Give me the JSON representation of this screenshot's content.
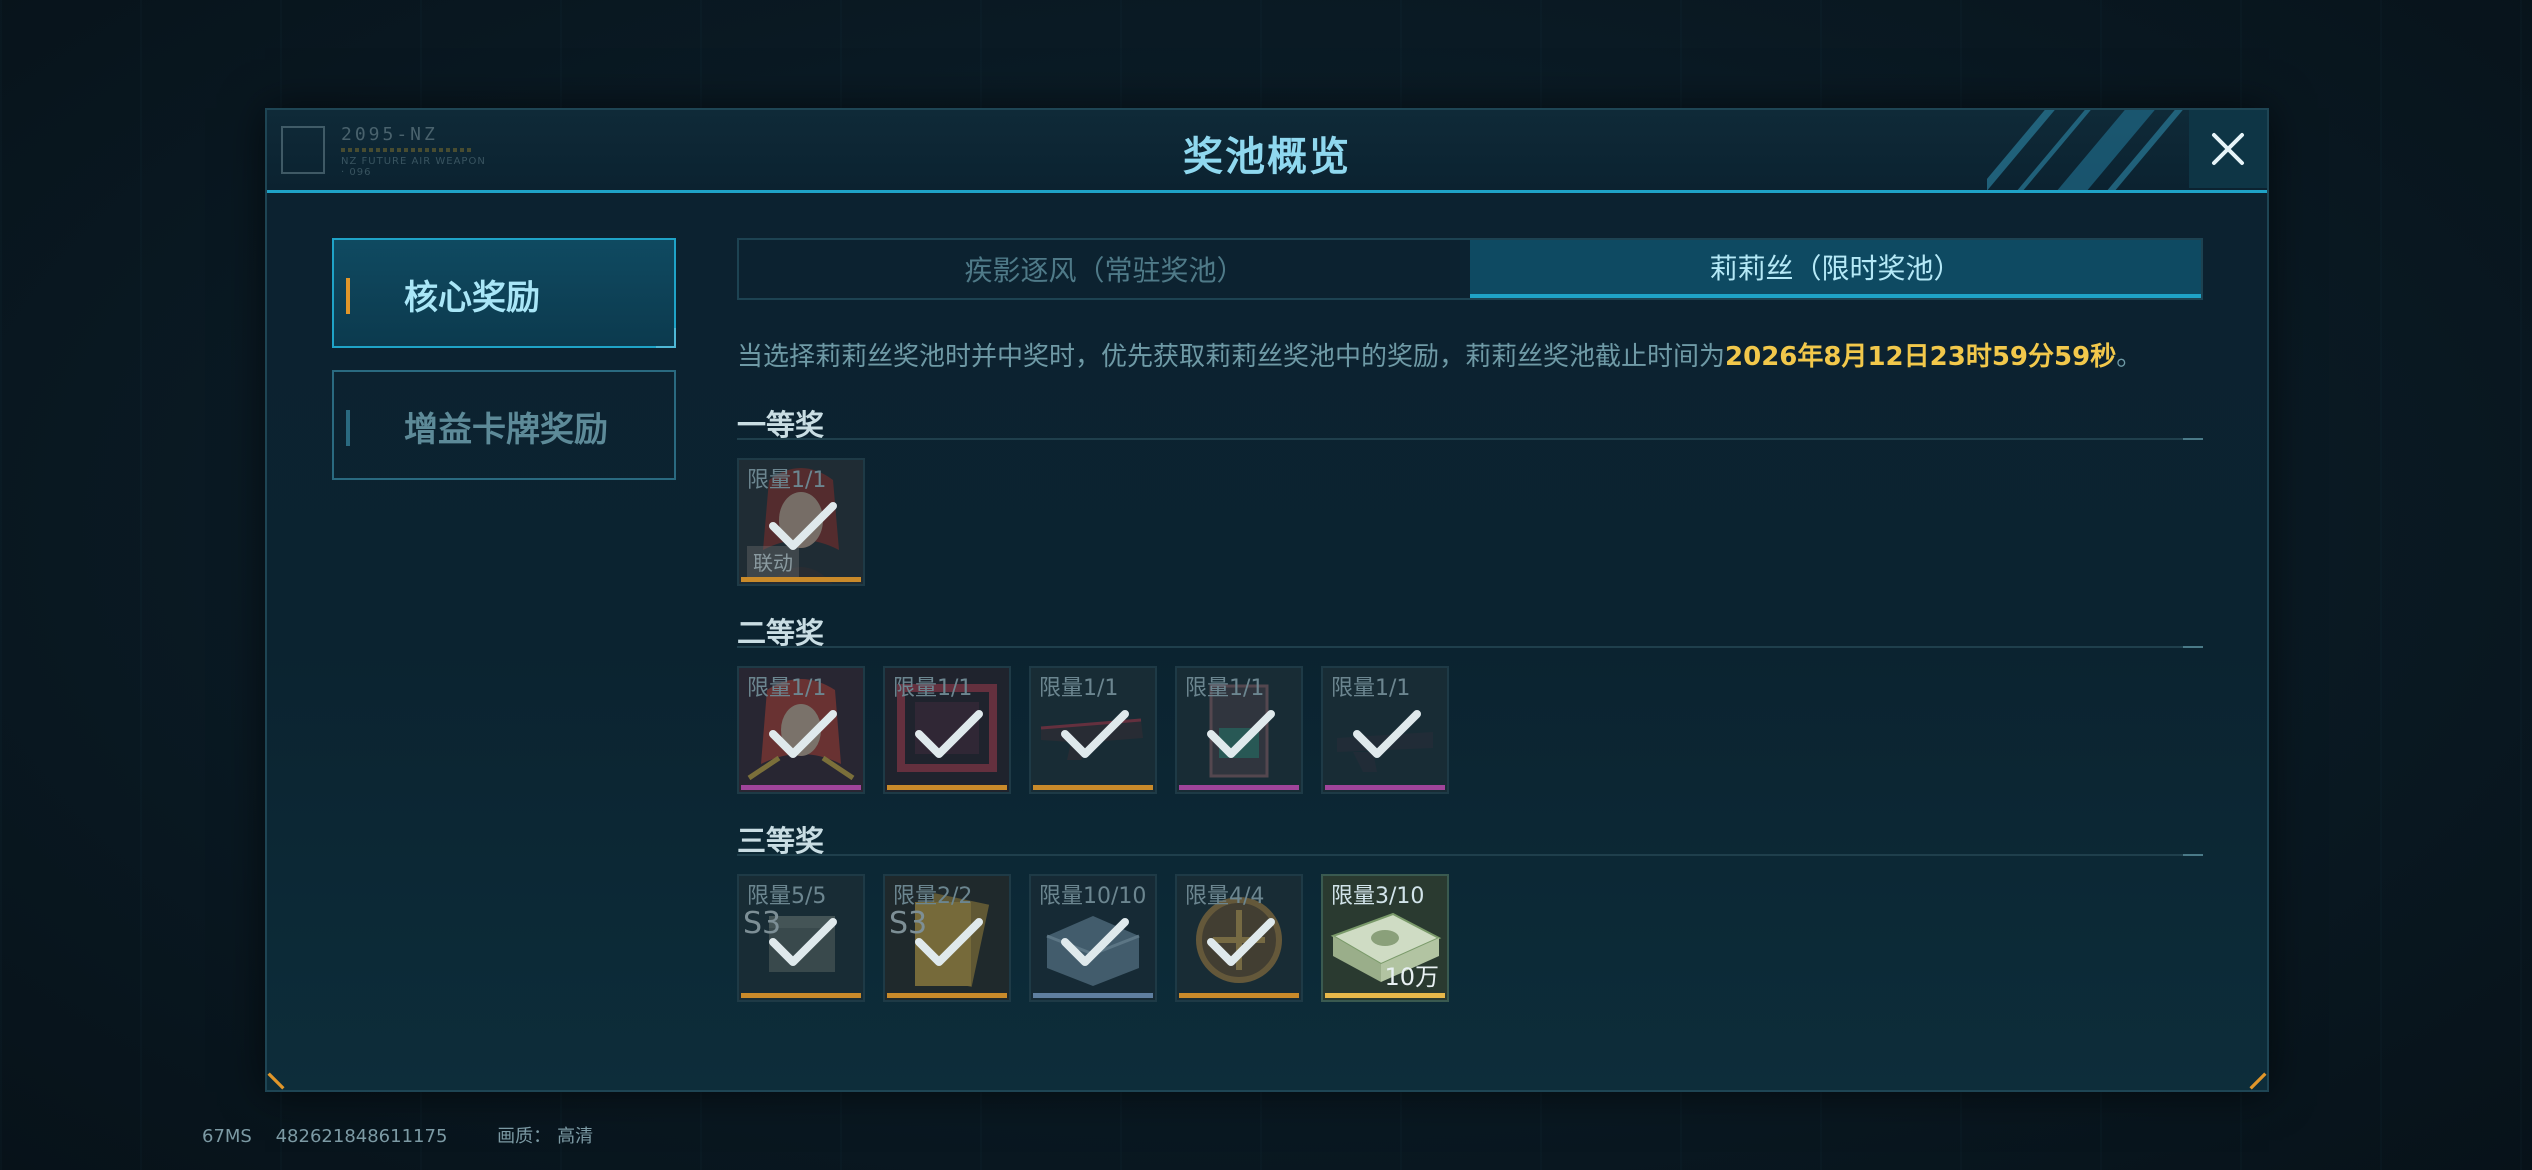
{
  "dialog": {
    "title": "奖池概览",
    "logo_code": "2095-NZ",
    "logo_sub": "NZ FUTURE AIR WEAPON · 096"
  },
  "nav": [
    {
      "label": "核心奖励",
      "active": true
    },
    {
      "label": "增益卡牌奖励",
      "active": false
    }
  ],
  "tabs": [
    {
      "label": "疾影逐风（常驻奖池）",
      "active": false
    },
    {
      "label": "莉莉丝（限时奖池）",
      "active": true
    }
  ],
  "notice": {
    "text": "当选择莉莉丝奖池时并中奖时，优先获取莉莉丝奖池中的奖励，莉莉丝奖池截止时间为",
    "deadline": "2026年8月12日23时59分59秒",
    "suffix": "。"
  },
  "sections": [
    {
      "title": "一等奖",
      "items": [
        {
          "limit": "限量1/1",
          "tag": "联动",
          "claimed": true,
          "rarity_color": "#c98a2a",
          "art": "portrait-red-hair"
        }
      ]
    },
    {
      "title": "二等奖",
      "items": [
        {
          "limit": "限量1/1",
          "claimed": true,
          "rarity_color": "#a0449a",
          "art": "portrait-red-hair-gold"
        },
        {
          "limit": "限量1/1",
          "claimed": true,
          "rarity_color": "#c98a2a",
          "art": "frame-crimson"
        },
        {
          "limit": "限量1/1",
          "claimed": true,
          "rarity_color": "#c98a2a",
          "art": "weapon-dark"
        },
        {
          "limit": "限量1/1",
          "claimed": true,
          "rarity_color": "#a0449a",
          "art": "card-dark"
        },
        {
          "limit": "限量1/1",
          "claimed": true,
          "rarity_color": "#a0449a",
          "art": "weapon-purple"
        }
      ]
    },
    {
      "title": "三等奖",
      "items": [
        {
          "limit": "限量5/5",
          "badge": "S3",
          "claimed": true,
          "rarity_color": "#c98a2a",
          "art": "crate-gray"
        },
        {
          "limit": "限量2/2",
          "badge": "S3",
          "claimed": true,
          "rarity_color": "#c98a2a",
          "art": "card-gold"
        },
        {
          "limit": "限量10/10",
          "claimed": true,
          "rarity_color": "#5f7fa0",
          "art": "crate-blue"
        },
        {
          "limit": "限量4/4",
          "claimed": true,
          "rarity_color": "#c98a2a",
          "art": "medal-bronze"
        },
        {
          "limit": "限量3/10",
          "amount": "10万",
          "claimed": false,
          "rarity_color": "#e8b84a",
          "art": "cash-stack"
        }
      ]
    }
  ],
  "footer": {
    "ping": "67MS",
    "uid": "482621848611175",
    "quality_label": "画质：",
    "quality_value": "高清"
  }
}
